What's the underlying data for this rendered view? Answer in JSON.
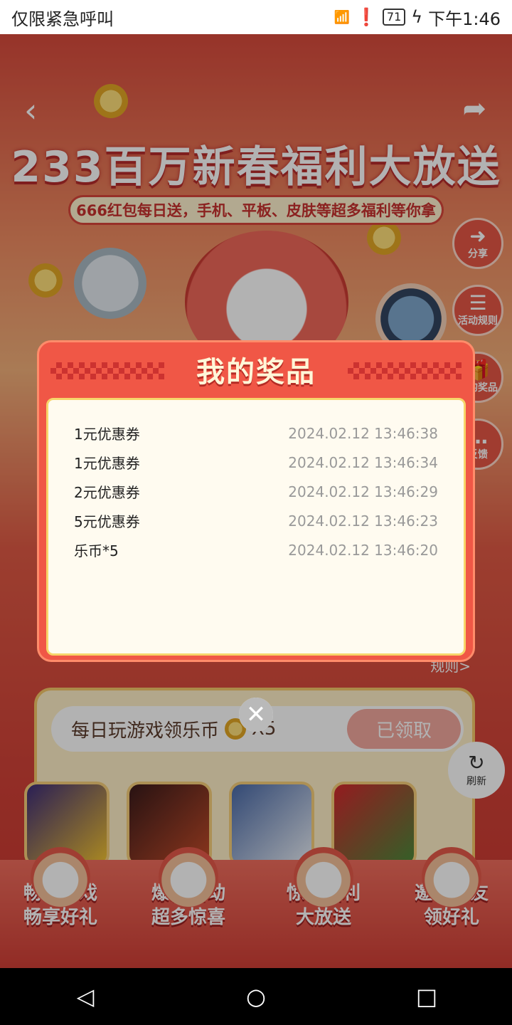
{
  "status_bar": {
    "left_text": "仅限紧急呼叫",
    "battery": "71",
    "time": "下午1:46"
  },
  "page": {
    "title": "233百万新春福利大放送",
    "subtitle": "666红包每日送，手机、平板、皮肤等超多福利等你拿",
    "side_buttons": [
      {
        "label": "分享"
      },
      {
        "label": "活动规则"
      },
      {
        "label": "我的奖品"
      },
      {
        "label": "反馈"
      }
    ],
    "task": {
      "text": "每日玩游戏领乐币",
      "multiplier": "X5",
      "button": "已领取"
    },
    "rule_link": "规则>",
    "refresh": "刷新",
    "bottom_nav": [
      {
        "line1": "畅享游戏",
        "line2": "畅享好礼"
      },
      {
        "line1": "爆款活动",
        "line2": "超多惊喜"
      },
      {
        "line1": "惊喜福利",
        "line2": "大放送"
      },
      {
        "line1": "邀请好友",
        "line2": "领好礼"
      }
    ]
  },
  "modal": {
    "title": "我的奖品",
    "prizes": [
      {
        "name": "1元优惠券",
        "time": "2024.02.12 13:46:38"
      },
      {
        "name": "1元优惠券",
        "time": "2024.02.12 13:46:34"
      },
      {
        "name": "2元优惠券",
        "time": "2024.02.12 13:46:29"
      },
      {
        "name": "5元优惠券",
        "time": "2024.02.12 13:46:23"
      },
      {
        "name": "乐币*5",
        "time": "2024.02.12 13:46:20"
      }
    ]
  }
}
